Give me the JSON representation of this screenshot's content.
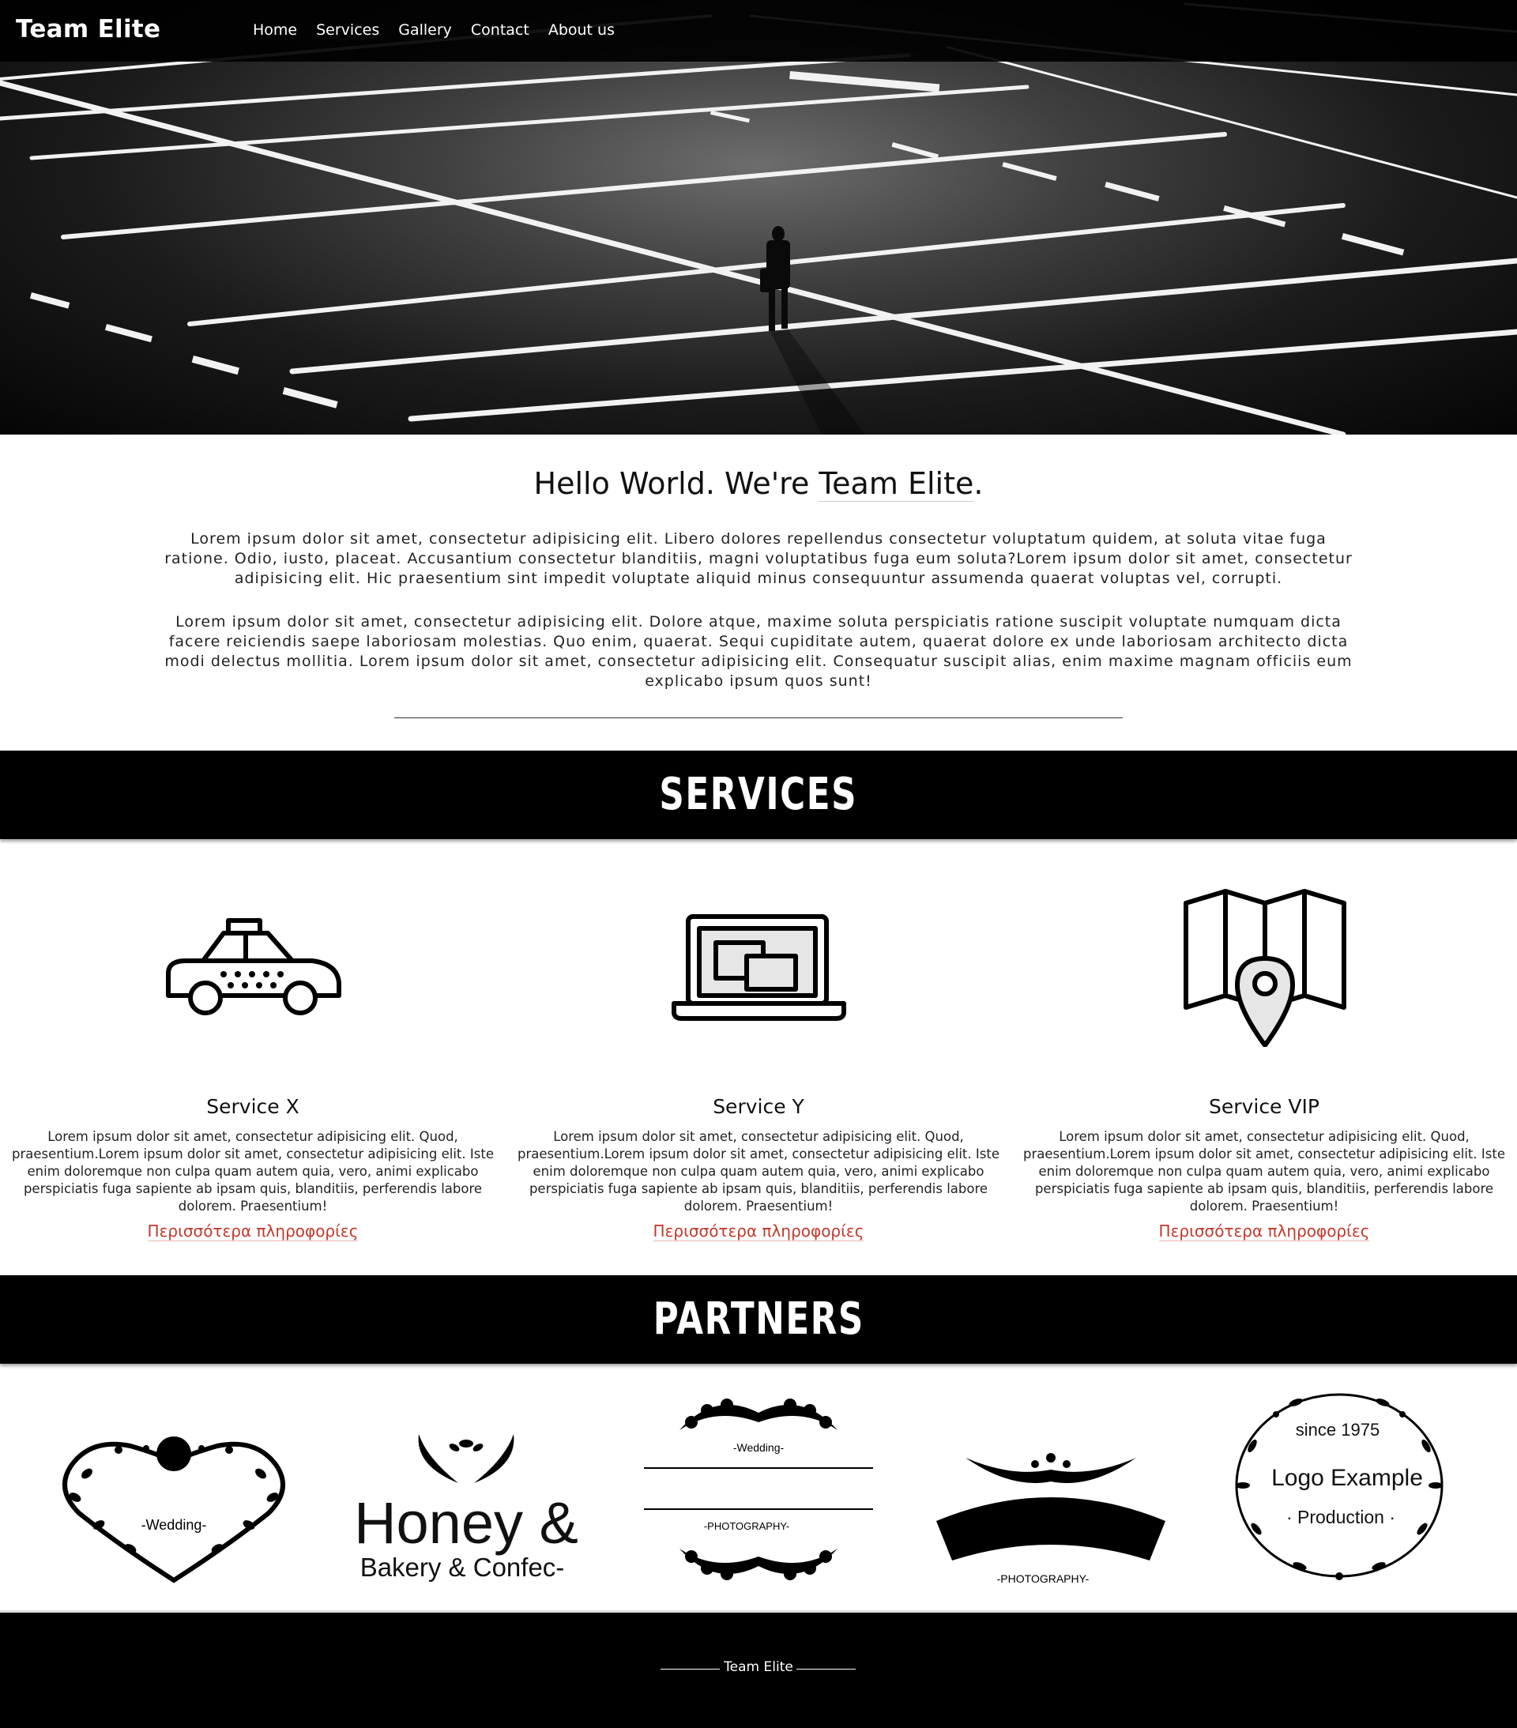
{
  "nav": {
    "brand": "Team Elite",
    "links": [
      "Home",
      "Services",
      "Gallery",
      "Contact",
      "About us"
    ]
  },
  "intro": {
    "title_prefix": "Hello World. We're ",
    "title_highlight": "Team Elite",
    "title_suffix": ".",
    "paragraph_1": "Lorem ipsum dolor sit amet, consectetur adipisicing elit. Libero dolores repellendus consectetur voluptatum quidem, at soluta vitae fuga ratione. Odio, iusto, placeat. Accusantium consectetur blanditiis, magni voluptatibus fuga eum soluta?Lorem ipsum dolor sit amet, consectetur adipisicing elit. Hic praesentium sint impedit voluptate aliquid minus consequuntur assumenda quaerat voluptas vel, corrupti.",
    "paragraph_2": "Lorem ipsum dolor sit amet, consectetur adipisicing elit. Dolore atque, maxime soluta perspiciatis ratione suscipit voluptate numquam dicta facere reiciendis saepe laboriosam molestias. Quo enim, quaerat. Sequi cupiditate autem, quaerat dolore ex unde laboriosam architecto dicta modi delectus mollitia. Lorem ipsum dolor sit amet, consectetur adipisicing elit. Consequatur suscipit alias, enim maxime magnam officiis eum explicabo ipsum quos sunt!"
  },
  "services": {
    "heading": "SERVICES",
    "items": [
      {
        "title": "Service X",
        "icon": "taxi-icon",
        "body": "Lorem ipsum dolor sit amet, consectetur adipisicing elit. Quod, praesentium.Lorem ipsum dolor sit amet, consectetur adipisicing elit. Iste enim doloremque non culpa quam autem quia, vero, animi explicabo perspiciatis fuga sapiente ab ipsam quis, blanditiis, perferendis labore dolorem. Praesentium!",
        "link": "Περισσότερα πληροφορίες"
      },
      {
        "title": "Service Y",
        "icon": "laptop-icon",
        "body": "Lorem ipsum dolor sit amet, consectetur adipisicing elit. Quod, praesentium.Lorem ipsum dolor sit amet, consectetur adipisicing elit. Iste enim doloremque non culpa quam autem quia, vero, animi explicabo perspiciatis fuga sapiente ab ipsam quis, blanditiis, perferendis labore dolorem. Praesentium!",
        "link": "Περισσότερα πληροφορίες"
      },
      {
        "title": "Service VIP",
        "icon": "map-pin-icon",
        "body": "Lorem ipsum dolor sit amet, consectetur adipisicing elit. Quod, praesentium.Lorem ipsum dolor sit amet, consectetur adipisicing elit. Iste enim doloremque non culpa quam autem quia, vero, animi explicabo perspiciatis fuga sapiente ab ipsam quis, blanditiis, perferendis labore dolorem. Praesentium!",
        "link": "Περισσότερα πληροφορίες"
      }
    ]
  },
  "partners": {
    "heading": "PARTNERS",
    "logos": [
      {
        "name": "wedding-heart-logo",
        "text": "-Wedding-"
      },
      {
        "name": "honey-bakery-logo",
        "text_1": "Honey &",
        "text_2": "Bakery & Confec-"
      },
      {
        "name": "wedding-photography-logo",
        "text_1": "-Wedding-",
        "text_2": "-PHOTOGRAPHY-"
      },
      {
        "name": "ribbon-photography-logo",
        "text": "-PHOTOGRAPHY-"
      },
      {
        "name": "wreath-logo",
        "text_1": "since 1975",
        "text_2": "Logo Example",
        "text_3": "· Production ·"
      }
    ]
  },
  "footer": {
    "text": "Team Elite"
  },
  "colors": {
    "link": "#c0392b",
    "band": "#000000",
    "text": "#111111"
  }
}
